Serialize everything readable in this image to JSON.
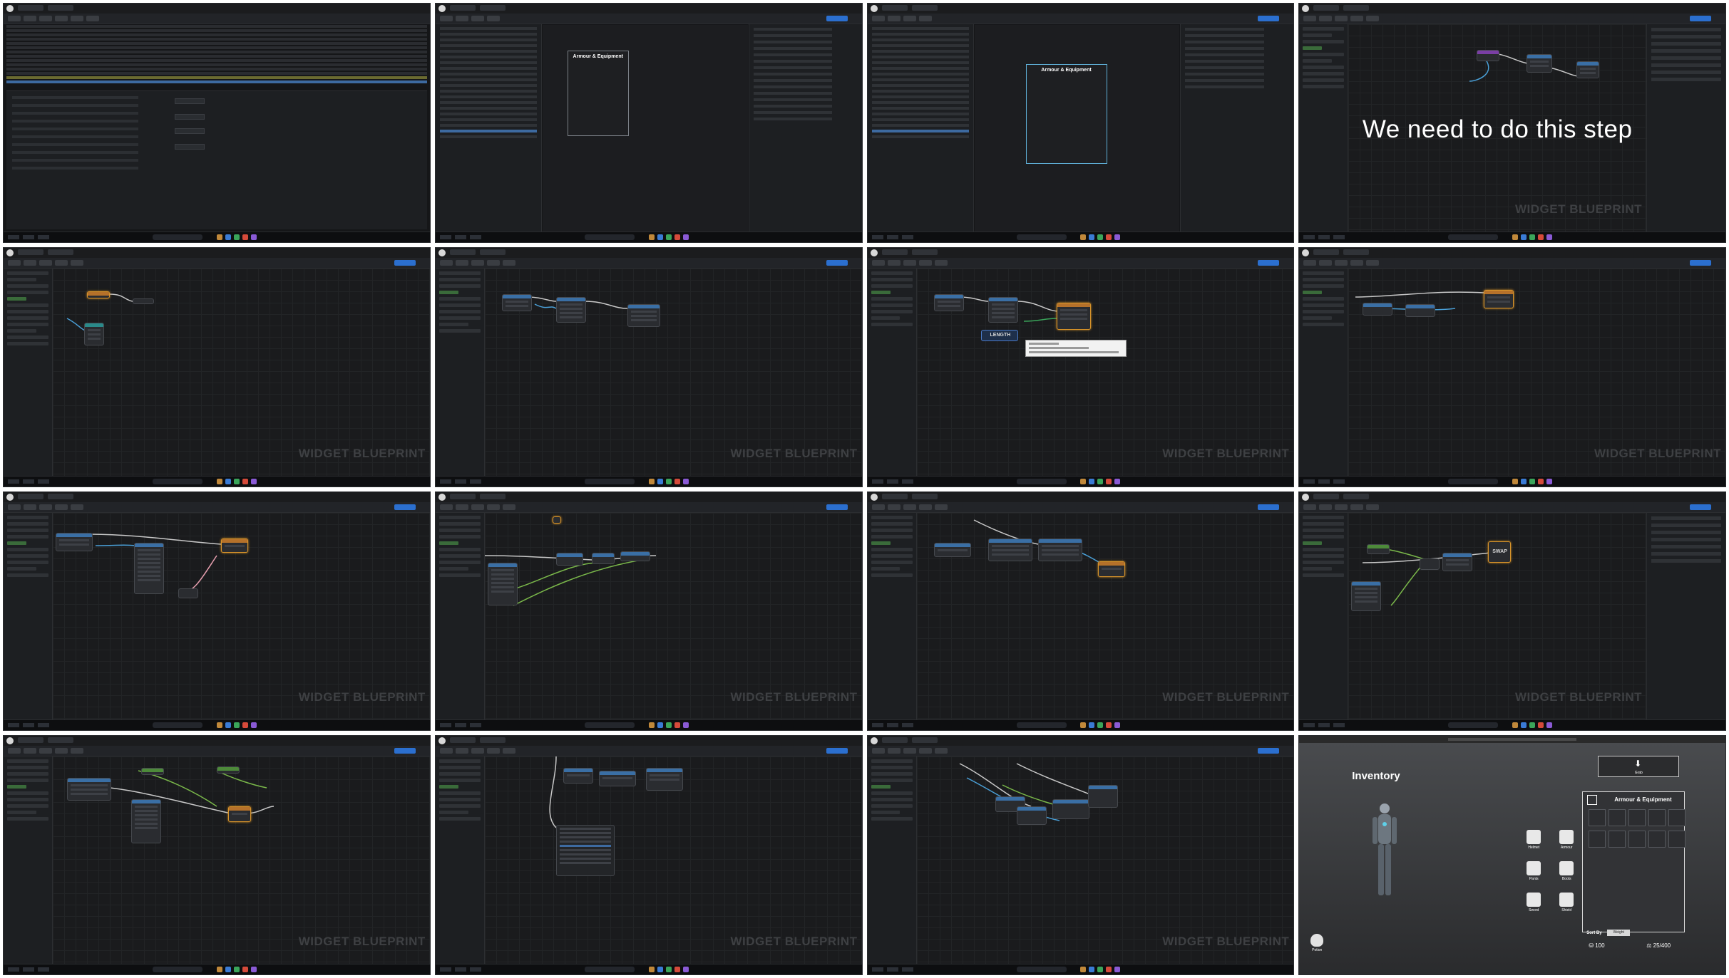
{
  "caption": "We need to do this step",
  "watermark": "WIDGET BLUEPRINT",
  "designer_widget_title": "Armour & Equipment",
  "graph_nodes": {
    "length": "LENGTH",
    "swap": "SWAP"
  },
  "game": {
    "title": "Inventory",
    "grab_label": "Grab",
    "panel_title": "Armour & Equipment",
    "equipment_slots": [
      "Helmet",
      "Armour",
      "Pants",
      "Boots",
      "Sword",
      "Shield"
    ],
    "sort_by_label": "Sort By",
    "sort_by_value": "Weight",
    "money": "100",
    "weight": "25/400",
    "potion_label": "Potion"
  },
  "icons": [
    "arrow-down-icon",
    "helmet-icon",
    "armour-icon",
    "pants-icon",
    "boots-icon",
    "sword-icon",
    "shield-icon",
    "potion-icon",
    "coin-icon",
    "weight-icon",
    "lock-icon"
  ]
}
